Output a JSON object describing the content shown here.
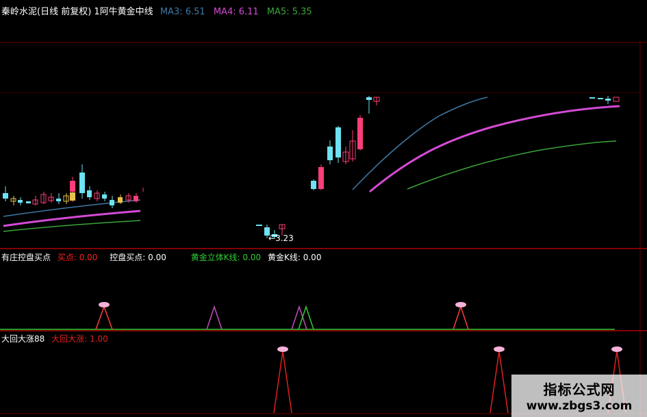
{
  "main_panel": {
    "title": "秦岭水泥(日线 前复权) 1阿牛黄金中线",
    "ma3_label": "MA3:",
    "ma3_value": "6.51",
    "ma4_label": "MA4:",
    "ma4_value": "6.11",
    "ma5_label": "MA5:",
    "ma5_value": "5.35",
    "low_price_label": "3.23",
    "colors": {
      "ma3": "#3f79a6",
      "ma4": "#d44bd4",
      "ma5": "#3aa63a",
      "candle_up": "#ff3d78",
      "candle_down": "#6de2f2",
      "candle_yellow": "#e6c24c",
      "divider": "#8b0000"
    }
  },
  "indicator_panel": {
    "title": "有庄控盘买点",
    "buy_label": "买点:",
    "buy_value": "0.00",
    "control_label": "控盘买点:",
    "control_value": "0.00",
    "golden_3d_label": "黄金立体K线:",
    "golden_3d_value": "0.00",
    "golden_k_label": "黄金K线:",
    "golden_k_value": "0.00",
    "colors": {
      "buy": "#ff2020",
      "golden_3d": "#33cc33"
    }
  },
  "lower_panel": {
    "title": "大回大涨88",
    "series_label": "大回大涨:",
    "series_value": "1.00",
    "colors": {
      "series": "#e02020"
    }
  },
  "watermark": {
    "title": "指标公式网",
    "url": "www.zbgs3.com"
  }
}
